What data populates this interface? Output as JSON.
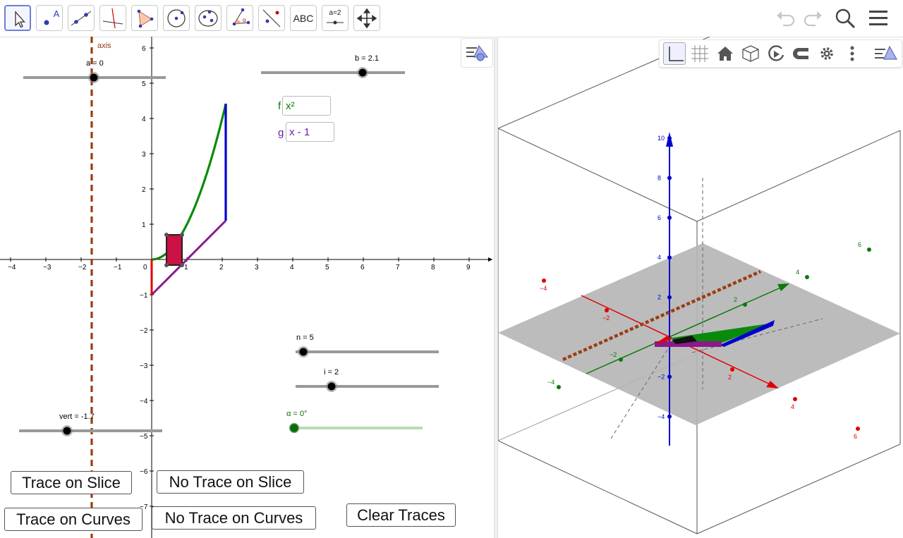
{
  "toolbar": {
    "tools": [
      {
        "name": "move-tool",
        "label": ""
      },
      {
        "name": "point-tool",
        "label": "A"
      },
      {
        "name": "line-tool",
        "label": ""
      },
      {
        "name": "perpendicular-line-tool",
        "label": ""
      },
      {
        "name": "polygon-tool",
        "label": ""
      },
      {
        "name": "circle-tool",
        "label": ""
      },
      {
        "name": "conic-tool",
        "label": ""
      },
      {
        "name": "angle-tool",
        "label": "α"
      },
      {
        "name": "reflect-tool",
        "label": ""
      },
      {
        "name": "text-tool",
        "label": "ABC"
      },
      {
        "name": "slider-tool",
        "label": "a=2"
      },
      {
        "name": "move-view-tool",
        "label": ""
      }
    ],
    "right_icons": [
      "undo-icon",
      "redo-icon",
      "search-icon",
      "menu-icon"
    ]
  },
  "graphics2d": {
    "axis_label": "axis",
    "x_ticks": [
      "−4",
      "−3",
      "−2",
      "−1",
      "0",
      "1",
      "2",
      "3",
      "4",
      "5",
      "6",
      "7",
      "8",
      "9"
    ],
    "y_ticks_pos": [
      "1",
      "2",
      "3",
      "4",
      "5",
      "6"
    ],
    "y_ticks_neg": [
      "−1",
      "−2",
      "−3",
      "−4",
      "−5",
      "−6",
      "−7"
    ],
    "sliders": {
      "a": {
        "label": "a = 0",
        "value": 0
      },
      "b": {
        "label": "b = 2.1",
        "value": 2.1
      },
      "n": {
        "label": "n = 5",
        "value": 5
      },
      "i": {
        "label": "i = 2",
        "value": 2
      },
      "alpha": {
        "label": "α = 0°",
        "value": 0
      },
      "vert": {
        "label": "vert = -1.7",
        "value": -1.7
      }
    },
    "functions": {
      "f": {
        "name": "f",
        "value": "x²",
        "color": "#0a7a0a"
      },
      "g": {
        "name": "g",
        "value": "x - 1",
        "color": "#6a1fb0"
      }
    },
    "buttons": {
      "trace_slice": "Trace on Slice",
      "no_trace_slice": "No Trace on Slice",
      "trace_curves": "Trace on Curves",
      "no_trace_curves": "No Trace on Curves",
      "clear": "Clear Traces"
    }
  },
  "graphics3d": {
    "z_ticks": [
      "10",
      "8",
      "6",
      "4",
      "2",
      "−2",
      "−4"
    ],
    "x_ticks": [
      "−4",
      "−2",
      "2",
      "4",
      "6"
    ],
    "y_ticks": [
      "−4",
      "−2",
      "2",
      "4",
      "6"
    ],
    "toolbar_icons": [
      "axes-icon",
      "grid-icon",
      "home-icon",
      "cube-view-icon",
      "rotate-icon",
      "projection-icon",
      "settings-icon",
      "more-icon"
    ]
  },
  "colors": {
    "accent": "#6d7fd8",
    "axis_dashed": "#8b3a0e",
    "green": "#0a8a0a",
    "blue": "#0000cc",
    "purple": "#8b1a8b",
    "red": "#e00000",
    "rect": "#cc1144"
  }
}
